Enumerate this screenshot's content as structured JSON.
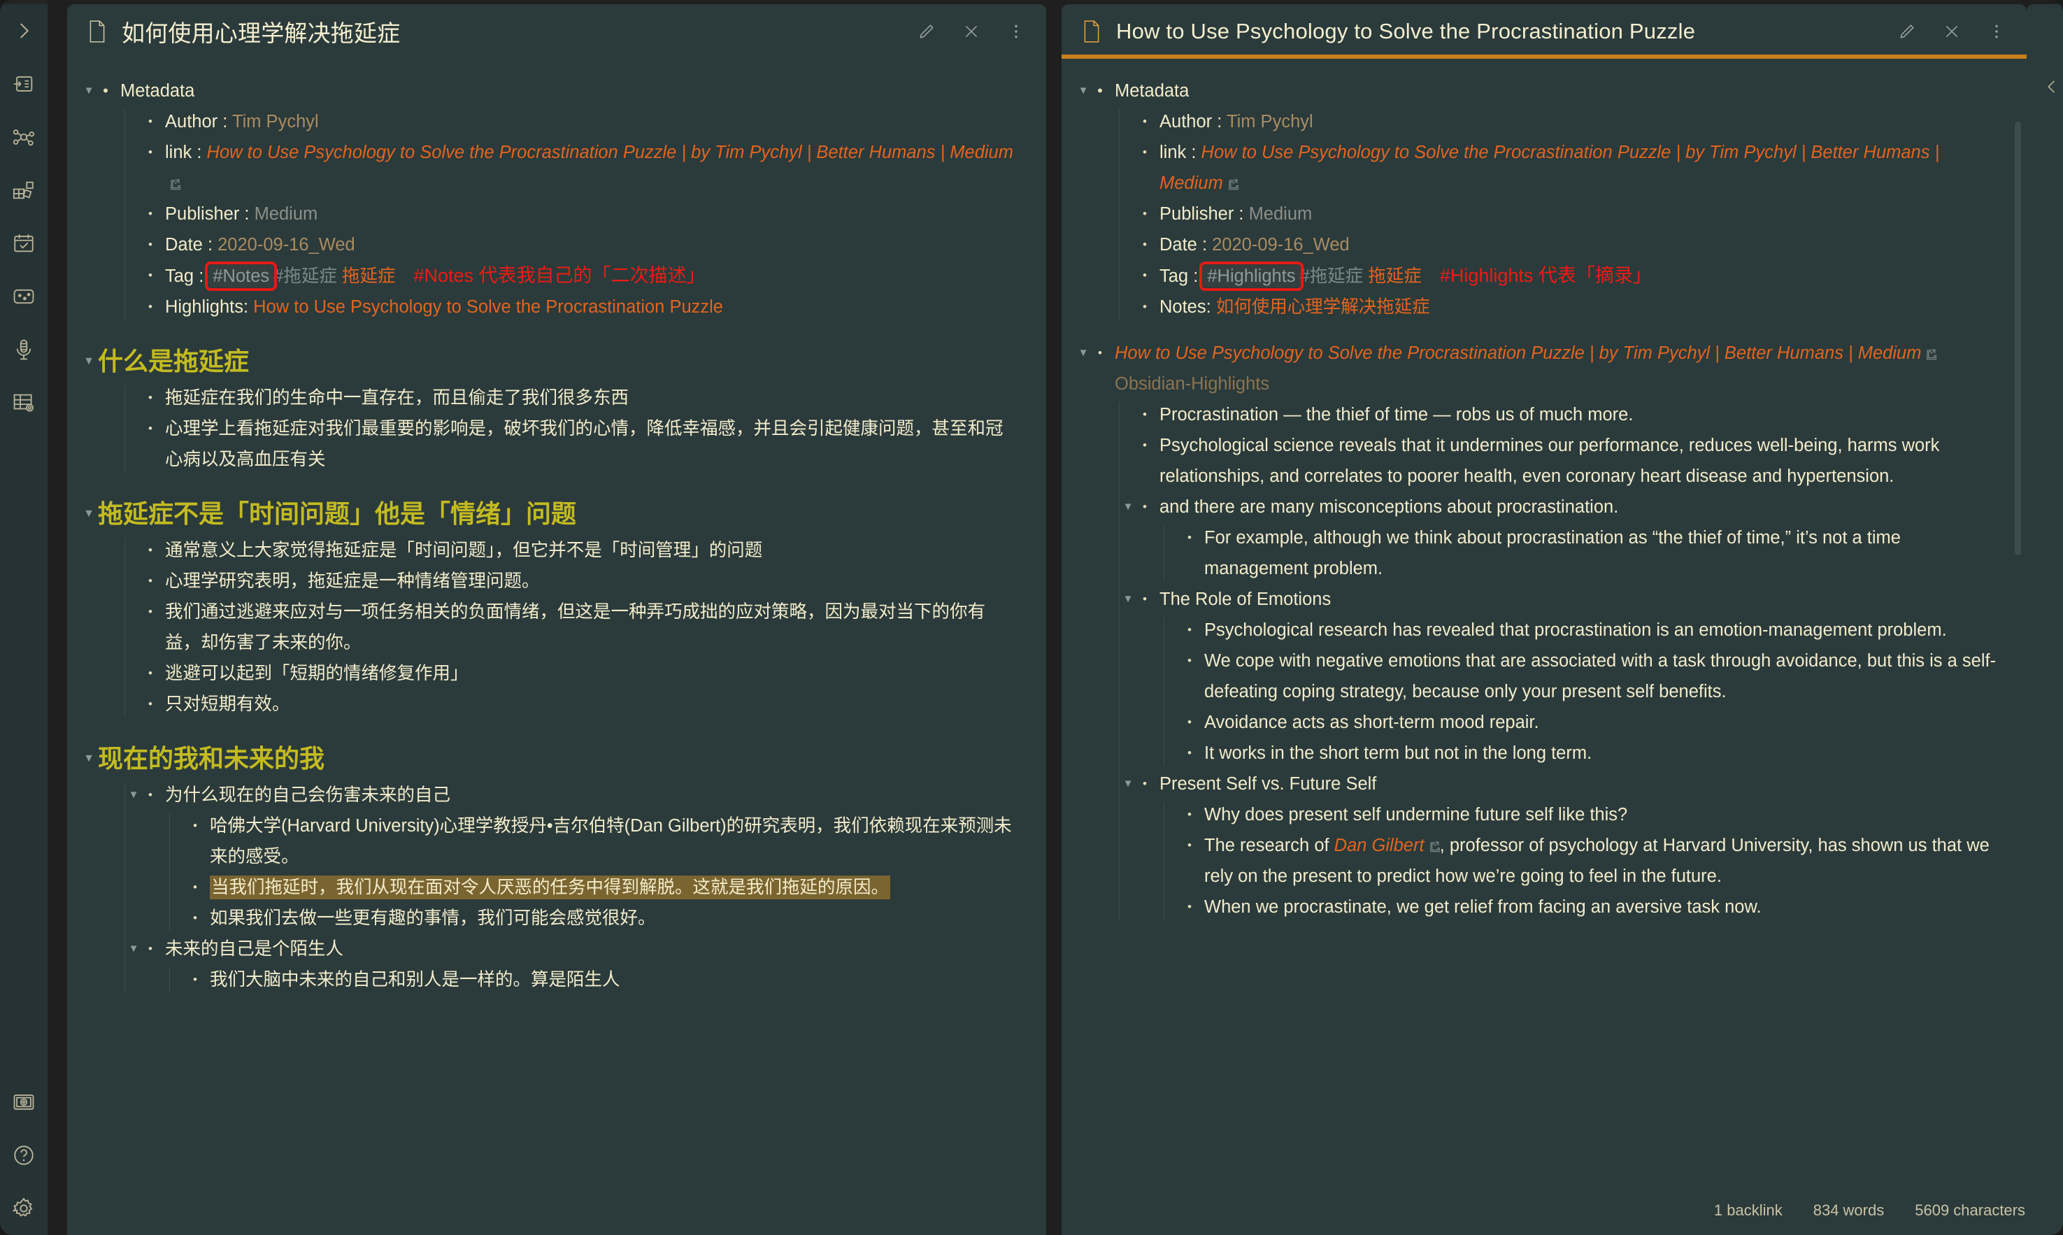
{
  "ribbon": {
    "top_icons": [
      {
        "name": "chevron-right-icon",
        "label": "Expand sidebar"
      },
      {
        "name": "quick-switcher-icon",
        "label": "Open quick switcher"
      },
      {
        "name": "graph-view-icon",
        "label": "Open graph view"
      },
      {
        "name": "canvas-icon",
        "label": "Create new canvas"
      },
      {
        "name": "calendar-icon",
        "label": "Open calendar"
      },
      {
        "name": "excalidraw-icon",
        "label": "Create new drawing"
      },
      {
        "name": "audio-recorder-icon",
        "label": "Start recording"
      },
      {
        "name": "database-icon",
        "label": "Open database view"
      }
    ],
    "bottom_icons": [
      {
        "name": "vault-icon",
        "label": "Open another vault"
      },
      {
        "name": "help-icon",
        "label": "Help"
      },
      {
        "name": "settings-gear-icon",
        "label": "Settings"
      }
    ]
  },
  "left_pane": {
    "title": "如何使用心理学解决拖延症",
    "header_actions": [
      {
        "name": "edit-pencil-icon",
        "label": "Edit"
      },
      {
        "name": "close-icon",
        "label": "Close"
      },
      {
        "name": "more-options-icon",
        "label": "More options"
      }
    ],
    "metadata": {
      "heading": "Metadata",
      "author_label": "Author : ",
      "author_value": "Tim Pychyl",
      "link_label": "link : ",
      "link_value": "How to Use Psychology to Solve the Procrastination Puzzle | by Tim Pychyl | Better Humans | Medium",
      "publisher_label": "Publisher : ",
      "publisher_value": "Medium",
      "date_label": "Date : ",
      "date_value": "2020-09-16_Wed",
      "tag_label": "Tag : ",
      "tag_chip": "#Notes",
      "tag_second": "#拖延症",
      "tag_third": "拖延症",
      "tag_annotation": "#Notes 代表我自己的「二次描述」",
      "highlights_label": "Highlights: ",
      "highlights_value": "How to Use Psychology to Solve the Procrastination Puzzle"
    },
    "sections": [
      {
        "heading": "什么是拖延症",
        "items": [
          "拖延症在我们的生命中一直存在，而且偷走了我们很多东西",
          "心理学上看拖延症对我们最重要的影响是，破坏我们的心情，降低幸福感，并且会引起健康问题，甚至和冠心病以及高血压有关"
        ]
      },
      {
        "heading": "拖延症不是「时间问题」他是「情绪」问题",
        "items": [
          "通常意义上大家觉得拖延症是「时间问题」，但它并不是「时间管理」的问题",
          "心理学研究表明，拖延症是一种情绪管理问题。",
          "我们通过逃避来应对与一项任务相关的负面情绪，但这是一种弄巧成拙的应对策略，因为最对当下的你有益，却伤害了未来的你。",
          "逃避可以起到「短期的情绪修复作用」",
          "只对短期有效。"
        ]
      },
      {
        "heading": "现在的我和未来的我",
        "sub": [
          {
            "title": "为什么现在的自己会伤害未来的自己",
            "items": [
              {
                "text": "哈佛大学(Harvard University)心理学教授丹•吉尔伯特(Dan Gilbert)的研究表明，我们依赖现在来预测未来的感受。",
                "highlight": false
              },
              {
                "text": "当我们拖延时，我们从现在面对令人厌恶的任务中得到解脱。这就是我们拖延的原因。",
                "highlight": true
              },
              {
                "text": "如果我们去做一些更有趣的事情，我们可能会感觉很好。",
                "highlight": false
              }
            ]
          },
          {
            "title": "未来的自己是个陌生人",
            "items": [
              {
                "text": "我们大脑中未来的自己和别人是一样的。算是陌生人",
                "highlight": false
              }
            ]
          }
        ]
      }
    ]
  },
  "right_pane": {
    "title": "How to Use Psychology to Solve the Procrastination Puzzle",
    "header_actions": [
      {
        "name": "edit-pencil-icon",
        "label": "Edit"
      },
      {
        "name": "close-icon",
        "label": "Close"
      },
      {
        "name": "more-options-icon",
        "label": "More options"
      }
    ],
    "metadata": {
      "heading": "Metadata",
      "author_label": "Author : ",
      "author_value": "Tim Pychyl",
      "link_label": "link : ",
      "link_value": "How to Use Psychology to Solve the Procrastination Puzzle | by Tim Pychyl | Better Humans | Medium",
      "publisher_label": "Publisher : ",
      "publisher_value": "Medium",
      "date_label": "Date : ",
      "date_value": "2020-09-16_Wed",
      "tag_label": "Tag : ",
      "tag_chip": "#Highlights",
      "tag_second": "#拖延症",
      "tag_third": "拖延症",
      "tag_annotation": "#Highlights 代表「摘录」",
      "notes_label": "Notes: ",
      "notes_value": "如何使用心理学解决拖延症"
    },
    "source": {
      "link_text": "How to Use Psychology to Solve the Procrastination Puzzle | by Tim Pychyl | Better Humans | Medium",
      "tag": "Obsidian-Highlights"
    },
    "highlights": [
      {
        "level": 1,
        "text": "Procrastination — the thief of time — robs us of much more.",
        "arrow": false
      },
      {
        "level": 1,
        "text": "Psychological science reveals that it undermines our performance, reduces well-being, harms work relationships, and correlates to poorer health, even coronary heart disease and hypertension.",
        "arrow": false
      },
      {
        "level": 0,
        "text": "and there are many misconceptions about procrastination.",
        "arrow": true
      },
      {
        "level": 1,
        "text": "For example, although we think about procrastination as “the thief of time,” it’s not a time management problem.",
        "arrow": false,
        "italic_word": "not"
      },
      {
        "level": 0,
        "text": "The Role of Emotions",
        "arrow": true
      },
      {
        "level": 1,
        "text": "Psychological research has revealed that procrastination is an emotion-management problem.",
        "arrow": false
      },
      {
        "level": 1,
        "text": "We cope with negative emotions that are associated with a task through avoidance, but this is a self-defeating coping strategy, because only your present self benefits.",
        "arrow": false
      },
      {
        "level": 1,
        "text": "Avoidance acts as short-term mood repair.",
        "arrow": false
      },
      {
        "level": 1,
        "text": "It works in the short term but not in the long term.",
        "arrow": false
      },
      {
        "level": 0,
        "text": "Present Self vs. Future Self",
        "arrow": true
      },
      {
        "level": 1,
        "text": "Why does present self undermine future self like this?",
        "arrow": false
      },
      {
        "level": 1,
        "text": "The research of Dan Gilbert, professor of psychology at Harvard University, has shown us that we rely on the present to predict how we’re going to feel in the future.",
        "arrow": false,
        "link_word": "Dan Gilbert"
      },
      {
        "level": 1,
        "text": "When we procrastinate, we get relief from facing an aversive task now.",
        "arrow": false
      }
    ]
  },
  "right_rail": {
    "collapse_icon": "chevron-left-icon"
  },
  "status_bar": {
    "backlinks": "1 backlink",
    "words": "834 words",
    "characters": "5609 characters"
  },
  "colors": {
    "pane_bg": "#2b3a3b",
    "text": "#f2eccb",
    "accent_orange": "#e2651f",
    "heading_olive": "#c3bb21",
    "annotation_red": "#ec1c14",
    "highlight_bg": "#7a6430",
    "active_underline": "#c87f1d"
  }
}
